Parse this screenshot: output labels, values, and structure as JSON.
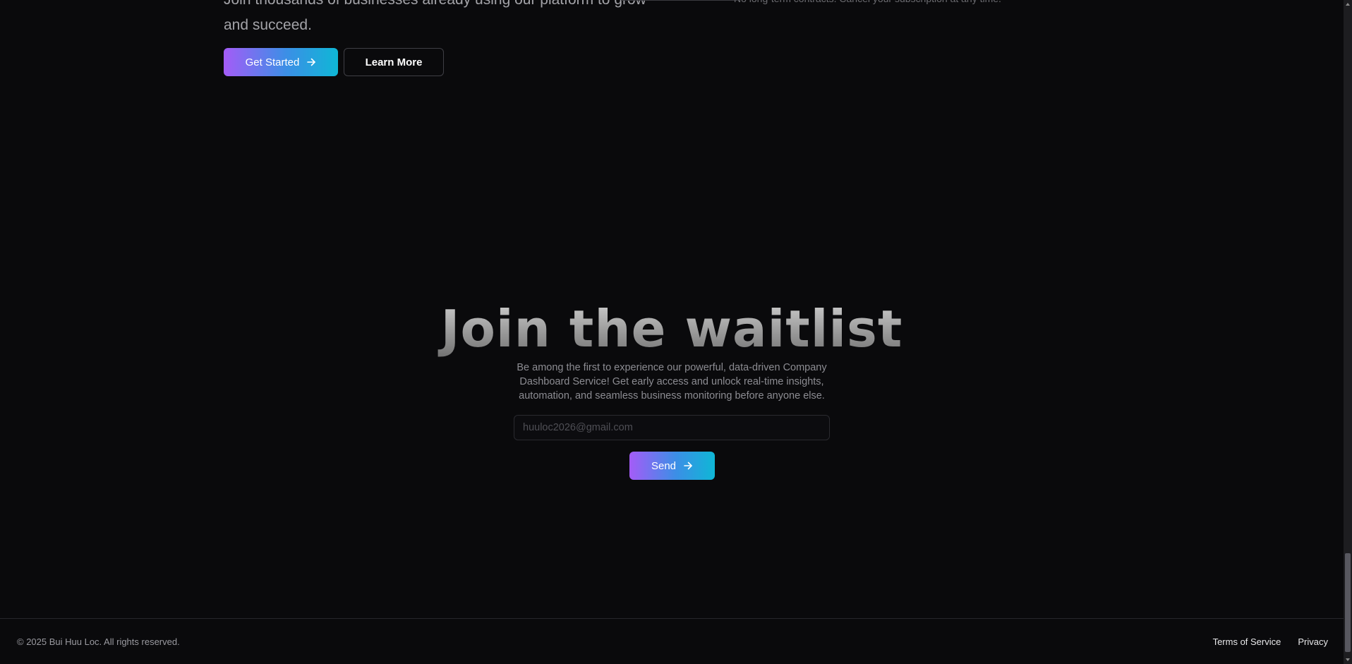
{
  "cta": {
    "text": "Join thousands of businesses already using our platform to grow and succeed.",
    "note": "No long-term contracts. Cancel your subscription at any time.",
    "get_started_label": "Get Started",
    "learn_more_label": "Learn More"
  },
  "waitlist": {
    "title": "Join the waitlist",
    "description": "Be among the first to experience our powerful, data-driven Company Dashboard Service! Get early access and unlock real-time insights, automation, and seamless business monitoring before anyone else.",
    "email_placeholder": "huuloc2026@gmail.com",
    "send_label": "Send"
  },
  "footer": {
    "copyright": "© 2025 Bui Huu Loc. All rights reserved.",
    "links": [
      {
        "label": "Terms of Service"
      },
      {
        "label": "Privacy"
      }
    ]
  },
  "icons": {
    "arrow": "arrow-right-icon"
  },
  "colors": {
    "background": "#0a0a0c",
    "gradient_start": "#a45cf7",
    "gradient_end": "#0fb7d6"
  }
}
